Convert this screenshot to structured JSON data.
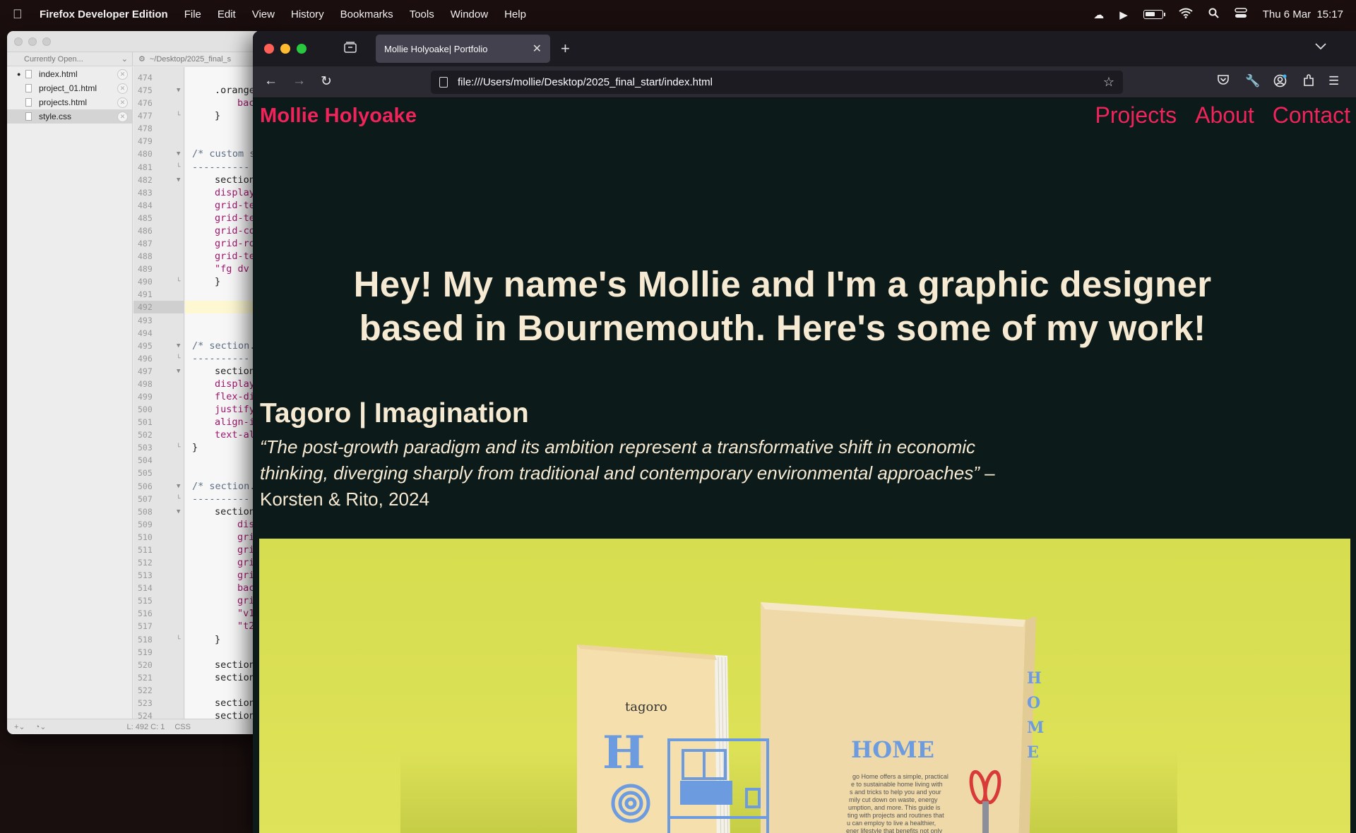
{
  "menubar": {
    "app_name": "Firefox Developer Edition",
    "items": [
      "File",
      "Edit",
      "View",
      "History",
      "Bookmarks",
      "Tools",
      "Window",
      "Help"
    ],
    "datetime": "Thu 6 Mar  15:17"
  },
  "editor": {
    "sidebar_header": "Currently Open...",
    "path": "~/Desktop/2025_final_s",
    "files": [
      {
        "name": "index.html",
        "active": false,
        "modified": true
      },
      {
        "name": "project_01.html",
        "active": false,
        "modified": false
      },
      {
        "name": "projects.html",
        "active": false,
        "modified": false
      },
      {
        "name": "style.css",
        "active": true,
        "modified": false
      }
    ],
    "line_numbers": [
      "474",
      "475",
      "476",
      "477",
      "478",
      "479",
      "480",
      "481",
      "482",
      "483",
      "484",
      "485",
      "486",
      "487",
      "488",
      "489",
      "490",
      "491",
      "492",
      "493",
      "494",
      "495",
      "496",
      "497",
      "498",
      "499",
      "500",
      "501",
      "502",
      "503",
      "504",
      "505",
      "506",
      "507",
      "508",
      "509",
      "510",
      "511",
      "512",
      "513",
      "514",
      "515",
      "516",
      "517",
      "518",
      "519",
      "520",
      "521",
      "522",
      "523",
      "524"
    ],
    "code_lines": [
      {
        "line": "475",
        "text": ".orange",
        "indent": 1,
        "kind": "sel"
      },
      {
        "line": "476",
        "text": "back",
        "indent": 2,
        "kind": "prop"
      },
      {
        "line": "477",
        "text": "}",
        "indent": 1,
        "kind": "sel"
      },
      {
        "line": "480",
        "text": "/*  custom s",
        "indent": 0,
        "kind": "comment"
      },
      {
        "line": "481",
        "text": "----------",
        "indent": 0,
        "kind": "comment"
      },
      {
        "line": "482",
        "text": "section.",
        "indent": 1,
        "kind": "sel"
      },
      {
        "line": "483",
        "text": "display:",
        "indent": 1,
        "kind": "prop"
      },
      {
        "line": "484",
        "text": "grid-tem",
        "indent": 1,
        "kind": "prop"
      },
      {
        "line": "485",
        "text": "grid-tem",
        "indent": 1,
        "kind": "prop"
      },
      {
        "line": "486",
        "text": "grid-col",
        "indent": 1,
        "kind": "prop"
      },
      {
        "line": "487",
        "text": "grid-row",
        "indent": 1,
        "kind": "prop"
      },
      {
        "line": "488",
        "text": "grid-tem",
        "indent": 1,
        "kind": "prop"
      },
      {
        "line": "489",
        "text": "\"fg dv d",
        "indent": 1,
        "kind": "str"
      },
      {
        "line": "490",
        "text": "}",
        "indent": 1,
        "kind": "sel"
      },
      {
        "line": "495",
        "text": "/*  section.",
        "indent": 0,
        "kind": "comment"
      },
      {
        "line": "496",
        "text": "----------",
        "indent": 0,
        "kind": "comment"
      },
      {
        "line": "497",
        "text": "section.",
        "indent": 1,
        "kind": "sel"
      },
      {
        "line": "498",
        "text": "display:",
        "indent": 1,
        "kind": "prop"
      },
      {
        "line": "499",
        "text": "flex-dir",
        "indent": 1,
        "kind": "prop"
      },
      {
        "line": "500",
        "text": "justify-",
        "indent": 1,
        "kind": "prop"
      },
      {
        "line": "501",
        "text": "align-it",
        "indent": 1,
        "kind": "prop"
      },
      {
        "line": "502",
        "text": "text-ali",
        "indent": 1,
        "kind": "prop"
      },
      {
        "line": "503",
        "text": "}",
        "indent": 0,
        "kind": "sel"
      },
      {
        "line": "506",
        "text": "/*  section.",
        "indent": 0,
        "kind": "comment"
      },
      {
        "line": "507",
        "text": "----------",
        "indent": 0,
        "kind": "comment"
      },
      {
        "line": "508",
        "text": "section.",
        "indent": 1,
        "kind": "sel"
      },
      {
        "line": "509",
        "text": "disp",
        "indent": 2,
        "kind": "prop"
      },
      {
        "line": "510",
        "text": "grid",
        "indent": 2,
        "kind": "prop"
      },
      {
        "line": "511",
        "text": "grid",
        "indent": 2,
        "kind": "prop"
      },
      {
        "line": "512",
        "text": "grid",
        "indent": 2,
        "kind": "prop"
      },
      {
        "line": "513",
        "text": "grid",
        "indent": 2,
        "kind": "prop"
      },
      {
        "line": "514",
        "text": "back",
        "indent": 2,
        "kind": "prop"
      },
      {
        "line": "515",
        "text": "grid",
        "indent": 2,
        "kind": "prop"
      },
      {
        "line": "516",
        "text": "\"v1",
        "indent": 2,
        "kind": "str"
      },
      {
        "line": "517",
        "text": "\"t2",
        "indent": 2,
        "kind": "str"
      },
      {
        "line": "518",
        "text": "}",
        "indent": 1,
        "kind": "sel"
      },
      {
        "line": "520",
        "text": "section.",
        "indent": 1,
        "kind": "sel"
      },
      {
        "line": "521",
        "text": "section.",
        "indent": 1,
        "kind": "sel"
      },
      {
        "line": "523",
        "text": "section.",
        "indent": 1,
        "kind": "sel"
      },
      {
        "line": "524",
        "text": "section.",
        "indent": 1,
        "kind": "sel"
      }
    ],
    "current_line": "492",
    "status_position": "L: 492 C: 1",
    "status_lang": "CSS"
  },
  "browser": {
    "tab_title": "Mollie Holyoake| Portfolio",
    "url": "file:///Users/mollie/Desktop/2025_final_start/index.html"
  },
  "site": {
    "brand": "Mollie Holyoake",
    "nav": [
      "Projects",
      "About",
      "Contact"
    ],
    "hero": "Hey! My name's Mollie and I'm a graphic designer based in Bournemouth. Here's some of my work!",
    "project_title": "Tagoro | Imagination",
    "quote_italic": "“The post-growth paradigm and its ambition represent a transformative shift in economic thinking, diverging sharply from traditional and contemporary environmental approaches”",
    "quote_cite": " – Korsten & Rito, 2024",
    "mockup": {
      "brand_text": "tagoro",
      "front_letter": "H",
      "back_title": "HOME",
      "spine_text": "HOME",
      "blurb": "Tagoro Home offers a simple, practical guide to sustainable home living with tips and tricks to help you and your family cut down on waste, energy consumption, and more. This guide is starting with projects and routines that you can employ to live a healthier, greener lifestyle that benefits not only yourself, but the planet."
    },
    "colors": {
      "accent": "#f0245a",
      "cream": "#f7ead3",
      "bg": "#0c1a1a",
      "image_bg": "#d8de52",
      "book_blue": "#6d9be0"
    }
  }
}
